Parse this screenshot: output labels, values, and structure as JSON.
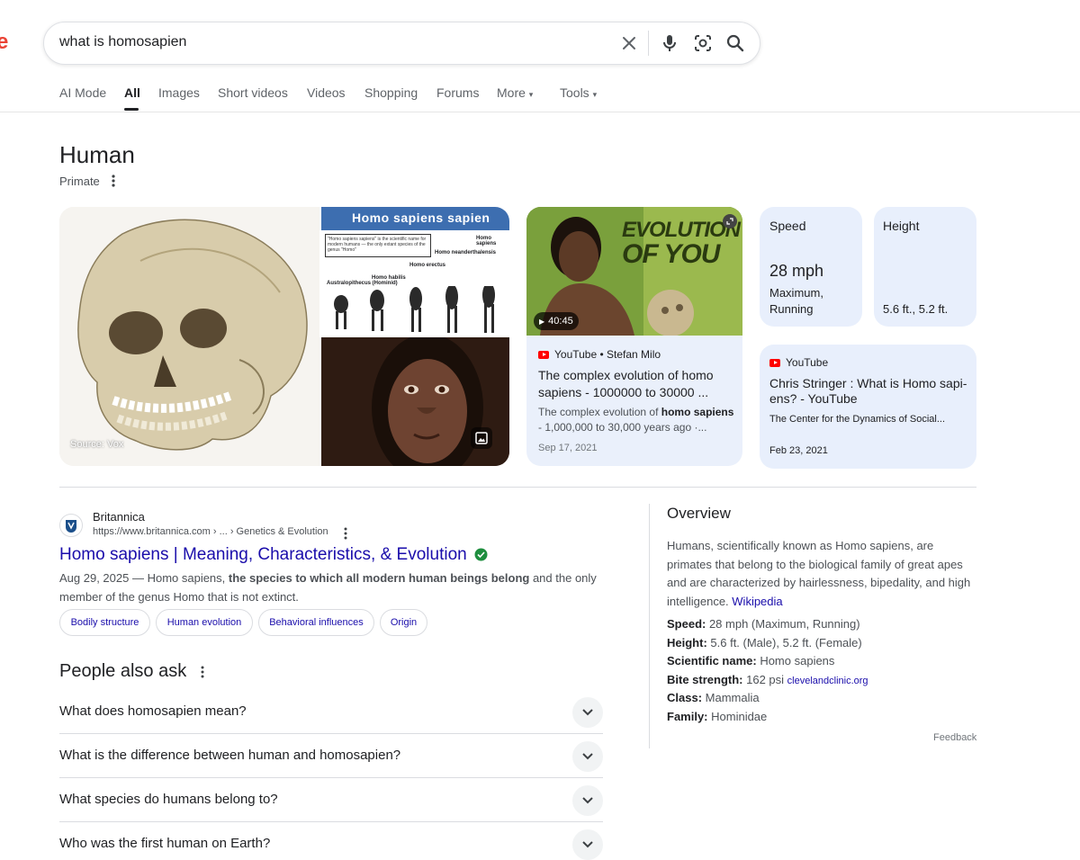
{
  "search": {
    "query": "what is homosapien"
  },
  "tabs": [
    "AI Mode",
    "All",
    "Images",
    "Short videos",
    "Videos",
    "Shopping",
    "Forums",
    "More",
    "Tools"
  ],
  "entity": {
    "title": "Human",
    "subtitle": "Primate"
  },
  "images": {
    "main_source": "Source: Vox",
    "banner_text": "Homo sapiens sapien",
    "chart_labels": [
      "Australopithecus (Hominid)",
      "Homo habilis",
      "Homo erectus",
      "Homo neanderthalensis",
      "Homo sapiens"
    ]
  },
  "video_card": {
    "thumb_text_1": "EVOLUTION",
    "thumb_text_2": "OF YOU",
    "duration": "40:45",
    "source": "YouTube • Stefan Milo",
    "title": "The complex evolution of homo sapiens - 1000000 to 30000 ...",
    "desc_prefix": "The complex evolution of ",
    "desc_bold": "homo sapiens",
    "desc_suffix": " - 1,000,000 to 30,000 years ago ·...",
    "date": "Sep 17, 2021"
  },
  "fact_cards": {
    "speed_label": "Speed",
    "speed_value": "28 mph",
    "speed_detail_1": "Maximum,",
    "speed_detail_2": "Running",
    "height_label": "Height",
    "height_value": "5.6 ft., 5.2 ft."
  },
  "yt_card": {
    "source": "YouTube",
    "title_1": "Chris Stringer : What is Homo sapi-",
    "title_2": "ens? - YouTube",
    "channel": "The Center for the Dynamics of Social...",
    "date": "Feb 23, 2021"
  },
  "result": {
    "site_name": "Britannica",
    "url": "https://www.britannica.com › ... › Genetics & Evolution",
    "title": "Homo sapiens | Meaning, Characteristics, & Evolution",
    "snippet_date": "Aug 29, 2025 — Homo sapiens, ",
    "snippet_bold": "the species to which all modern human beings belong",
    "snippet_rest": " and the only member of the genus Homo that is not extinct.",
    "chips": [
      "Bodily structure",
      "Human evolution",
      "Behavioral influences",
      "Origin"
    ]
  },
  "paa": {
    "title": "People also ask",
    "questions": [
      "What does homosapien mean?",
      "What is the difference between human and homosapien?",
      "What species do humans belong to?",
      "Who was the first human on Earth?"
    ]
  },
  "overview": {
    "title": "Overview",
    "text": "Humans, scientifically known as Homo sapiens, are primates that belong to the biological family of great apes and are characterized by hairlessness, bipedality, and high intelligence. ",
    "link": "Wikipedia",
    "facts": [
      {
        "label": "Speed:",
        "value": " 28 mph (Maximum, Running)"
      },
      {
        "label": "Height:",
        "value": " 5.6 ft. (Male), 5.2 ft. (Female)"
      },
      {
        "label": "Scientific name:",
        "value": " Homo sapiens"
      },
      {
        "label": "Bite strength:",
        "value": " 162 psi ",
        "link": "clevelandclinic.org"
      },
      {
        "label": "Class:",
        "value": " Mammalia"
      },
      {
        "label": "Family:",
        "value": " Hominidae"
      }
    ],
    "feedback": "Feedback"
  }
}
